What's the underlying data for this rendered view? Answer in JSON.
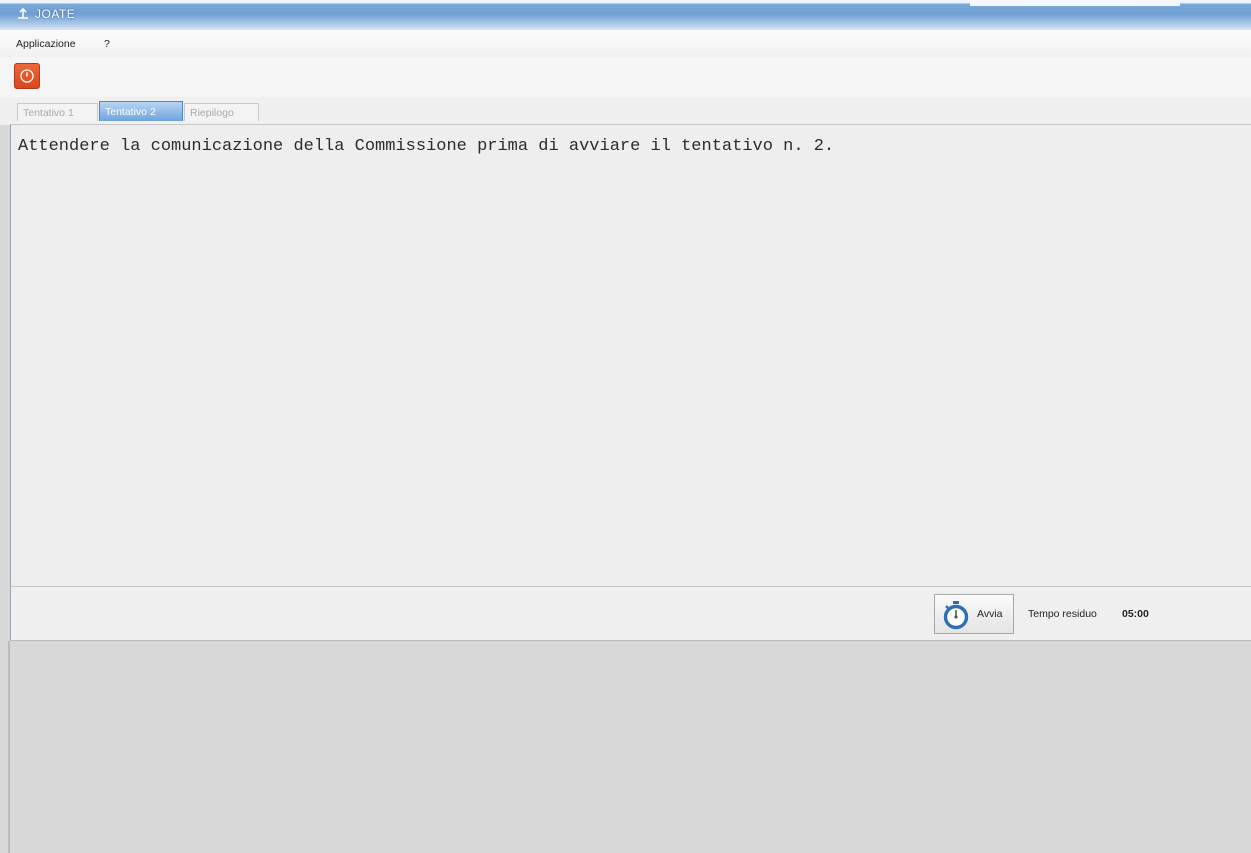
{
  "window": {
    "title": "JOATE"
  },
  "menubar": {
    "items": [
      "Applicazione",
      "?"
    ]
  },
  "toolbar": {
    "exit_icon": "power-icon",
    "exit_color": "#e4572e"
  },
  "tabs": [
    {
      "label": "Tentativo 1",
      "state": "disabled"
    },
    {
      "label": "Tentativo 2",
      "state": "selected"
    },
    {
      "label": "Riepilogo",
      "state": "disabled"
    }
  ],
  "main": {
    "message": "Attendere la comunicazione della Commissione prima di avviare il tentativo n. 2."
  },
  "footer": {
    "start_label": "Avvia",
    "start_icon": "stopwatch-icon",
    "time_label": "Tempo residuo",
    "time_value": "05:00"
  },
  "colors": {
    "accent": "#6ea3dc",
    "content_bg": "#eeeeee",
    "desktop_bg": "#d8d8d8"
  }
}
